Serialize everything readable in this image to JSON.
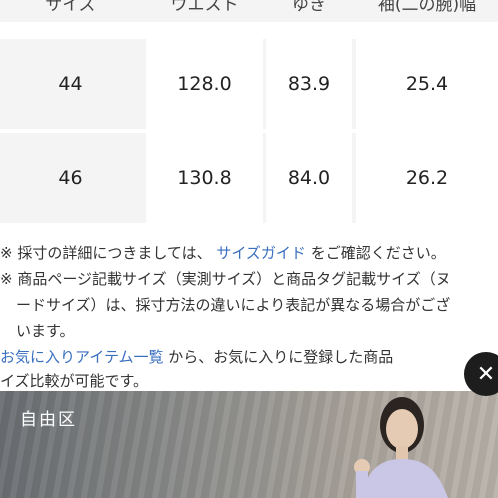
{
  "table": {
    "headers": [
      "サイズ",
      "ウエスト",
      "ゆき",
      "袖(二の腕)幅"
    ],
    "rows": [
      [
        "44",
        "128.0",
        "83.9",
        "25.4"
      ],
      [
        "46",
        "130.8",
        "84.0",
        "26.2"
      ]
    ]
  },
  "notes": {
    "line1_prefix": "※ 採寸の詳細につきましては、",
    "line1_link": "サイズガイド",
    "line1_suffix": "をご確認ください。",
    "line2": "※ 商品ページ記載サイズ（実測サイズ）と商品タグ記載サイズ（ヌ",
    "line3": "ードサイズ）は、採寸方法の違いにより表記が異なる場合がござ",
    "line4": "います。",
    "line5_link": "お気に入りアイテム一覧",
    "line5_suffix": "から、お気に入りに登録した商品",
    "line6": "イズ比較が可能です。"
  },
  "ad": {
    "brand": "自由区"
  },
  "close_glyph": "✕",
  "colors": {
    "link": "#3a6fbf",
    "cell_bg": "#f4f4f4",
    "close_bg": "#1d1d1d"
  }
}
